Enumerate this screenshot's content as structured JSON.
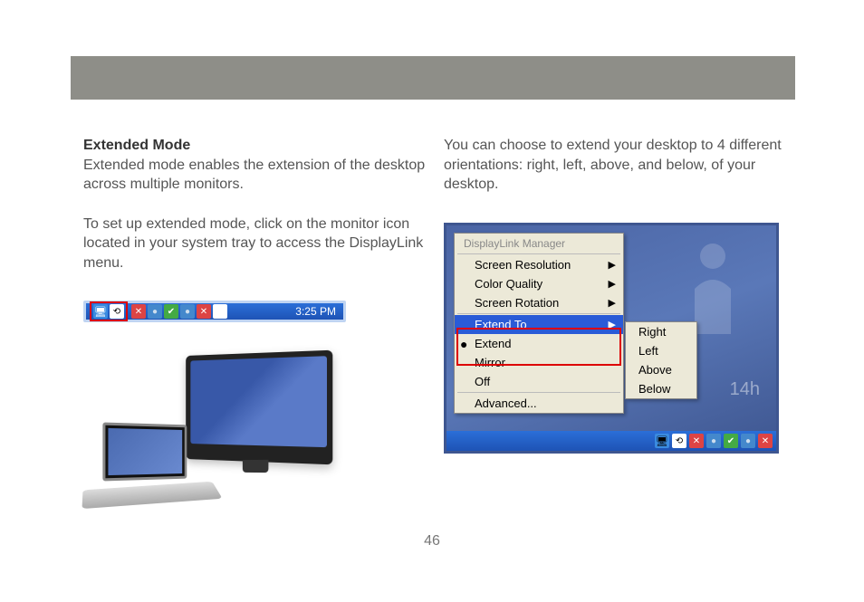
{
  "page_number": "46",
  "left_column": {
    "heading": "Extended Mode",
    "para1": "Extended mode enables the extension of the desktop across multiple monitors.",
    "para2": "To set up extended mode, click on the monitor icon located in your system tray to access the DisplayLink menu."
  },
  "right_column": {
    "para1": "You can choose to extend your desktop to 4 different orientations: right, left, above, and below, of your desktop."
  },
  "tray": {
    "time": "3:25 PM"
  },
  "menu": {
    "title": "DisplayLink Manager",
    "items": {
      "screen_resolution": "Screen Resolution",
      "color_quality": "Color Quality",
      "screen_rotation": "Screen Rotation",
      "extend_to": "Extend To",
      "extend": "Extend",
      "mirror": "Mirror",
      "off": "Off",
      "advanced": "Advanced..."
    },
    "submenu": {
      "right": "Right",
      "left": "Left",
      "above": "Above",
      "below": "Below"
    },
    "clock_hint": "14h"
  }
}
